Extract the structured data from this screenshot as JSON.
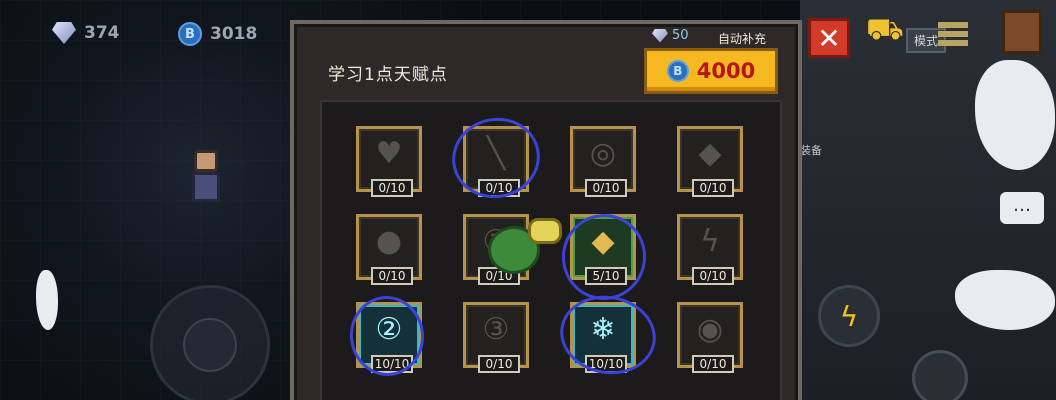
{
  "hud": {
    "gems": "374",
    "coins": "3018"
  },
  "panel": {
    "title": "学习1点天赋点",
    "gem_count": "50",
    "auto_label": "自动补充",
    "cost": "4000"
  },
  "side": {
    "mode_label": "模式",
    "equip_label": "装备"
  },
  "talents": [
    {
      "icon": "heart-icon",
      "glyph": "♥",
      "level": "0/10",
      "state": "locked"
    },
    {
      "icon": "bone-icon",
      "glyph": "╲",
      "level": "0/10",
      "state": "locked"
    },
    {
      "icon": "swirl-icon",
      "glyph": "◎",
      "level": "0/10",
      "state": "locked"
    },
    {
      "icon": "drop-icon",
      "glyph": "◆",
      "level": "0/10",
      "state": "locked"
    },
    {
      "icon": "orbs-icon",
      "glyph": "●",
      "level": "0/10",
      "state": "locked"
    },
    {
      "icon": "number-one-icon",
      "glyph": "①",
      "level": "0/10",
      "state": "locked"
    },
    {
      "icon": "gold-diamond-icon",
      "glyph": "◆",
      "level": "5/10",
      "state": "active"
    },
    {
      "icon": "lightning-icon",
      "glyph": "ϟ",
      "level": "0/10",
      "state": "locked"
    },
    {
      "icon": "number-two-icon",
      "glyph": "②",
      "level": "10/10",
      "state": "cyan"
    },
    {
      "icon": "number-three-icon",
      "glyph": "③",
      "level": "0/10",
      "state": "locked"
    },
    {
      "icon": "snowflake-icon",
      "glyph": "❄",
      "level": "10/10",
      "state": "cyan"
    },
    {
      "icon": "eye-icon",
      "glyph": "◉",
      "level": "0/10",
      "state": "locked"
    }
  ],
  "colors": {
    "panel_bg": "#2e2928",
    "slot_border": "#b7924a",
    "cost_button": "#f5b820",
    "cost_text": "#b4161a",
    "annotation": "#3a43d8"
  }
}
